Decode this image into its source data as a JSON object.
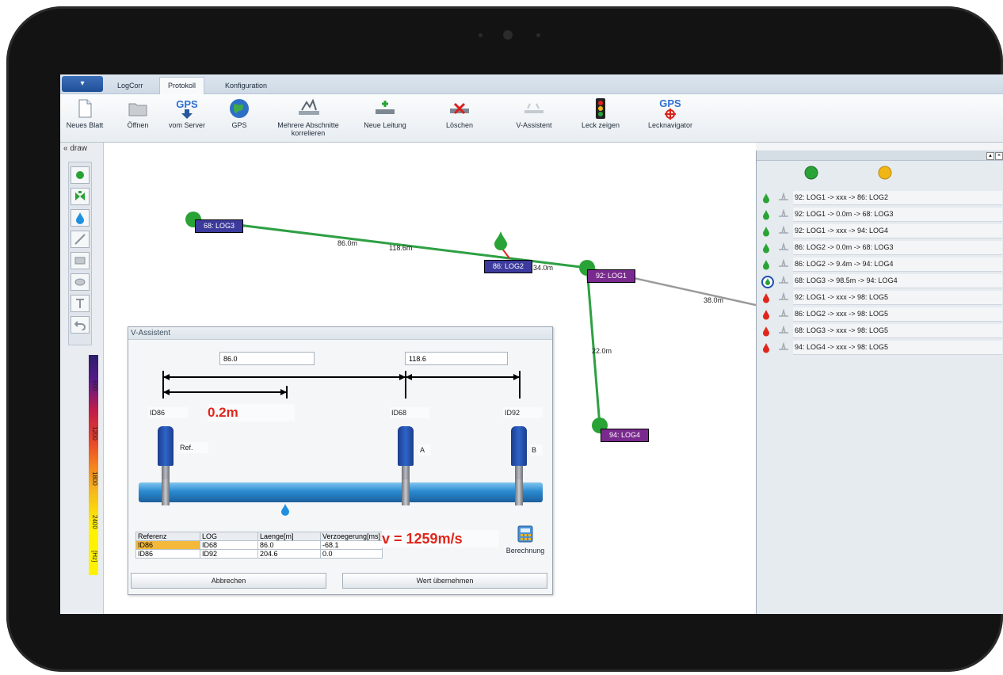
{
  "ribbon": {
    "tabs": [
      "LogCorr",
      "Protokoll",
      "Konfiguration"
    ],
    "active_tab": "Protokoll",
    "buttons": [
      {
        "label": "Neues Blatt",
        "icon": "new-sheet-icon"
      },
      {
        "label": "Öffnen",
        "icon": "folder-icon"
      },
      {
        "label": "vom Server",
        "icon": "gps-download-icon"
      },
      {
        "label": "GPS",
        "icon": "globe-icon"
      },
      {
        "label": "Mehrere Abschnitte korrelieren",
        "icon": "correlate-icon"
      },
      {
        "label": "Neue Leitung",
        "icon": "new-pipe-icon"
      },
      {
        "label": "Löschen",
        "icon": "delete-pipe-icon"
      },
      {
        "label": "V-Assistent",
        "icon": "v-assistant-icon"
      },
      {
        "label": "Leck zeigen",
        "icon": "traffic-light-icon"
      },
      {
        "label": "Lecknavigator",
        "icon": "gps-target-icon"
      }
    ],
    "gps_text": "GPS"
  },
  "toolbox": {
    "header": "draw",
    "scale_labels": [
      "600",
      "1200",
      "1800",
      "2400",
      "[Hz]"
    ]
  },
  "canvas": {
    "nodes": [
      "68: LOG3",
      "86: LOG2",
      "92: LOG1",
      "94: LOG4"
    ],
    "distances": {
      "d1": "86.0m",
      "d2": "118.6m",
      "d3": "34.0m",
      "d4": "38.0m",
      "d5": "22.0m"
    }
  },
  "right_panel": {
    "entries": [
      {
        "text": "92: LOG1 -> xxx -> 86: LOG2",
        "status": "green"
      },
      {
        "text": "92: LOG1 -> 0.0m -> 68: LOG3",
        "status": "green"
      },
      {
        "text": "92: LOG1 -> xxx -> 94: LOG4",
        "status": "green"
      },
      {
        "text": "86: LOG2 -> 0.0m -> 68: LOG3",
        "status": "green"
      },
      {
        "text": "86: LOG2 -> 9.4m -> 94: LOG4",
        "status": "green"
      },
      {
        "text": "68: LOG3 -> 98.5m -> 94: LOG4",
        "status": "selected"
      },
      {
        "text": "92: LOG1 -> xxx -> 98: LOG5",
        "status": "red"
      },
      {
        "text": "86: LOG2 -> xxx -> 98: LOG5",
        "status": "red"
      },
      {
        "text": "68: LOG3 -> xxx -> 98: LOG5",
        "status": "red"
      },
      {
        "text": "94: LOG4 -> xxx -> 98: LOG5",
        "status": "red"
      }
    ]
  },
  "dialog": {
    "title": "V-Assistent",
    "field_left": "86.0",
    "field_right": "118.6",
    "sensor_ids": [
      "ID86",
      "ID68",
      "ID92"
    ],
    "leak_distance": "0.2m",
    "sensor_tags": [
      "Ref.",
      "A",
      "B"
    ],
    "table": {
      "headers": [
        "Referenz",
        "LOG",
        "Laenge[m]",
        "Verzoegerung[ms]"
      ],
      "rows": [
        [
          "ID86",
          "ID68",
          "86.0",
          "-68.1"
        ],
        [
          "ID86",
          "ID92",
          "204.6",
          "0.0"
        ]
      ]
    },
    "velocity": "v = 1259m/s",
    "calc_label": "Berechnung",
    "cancel_label": "Abbrechen",
    "accept_label": "Wert übernehmen"
  },
  "colors": {
    "node_label_blue": "#3c3a9c",
    "node_label_purple": "#7a2a8e",
    "pipe_green": "#2ea043",
    "pipe_gray": "#9a9a9a",
    "accent_red": "#e0261b"
  }
}
